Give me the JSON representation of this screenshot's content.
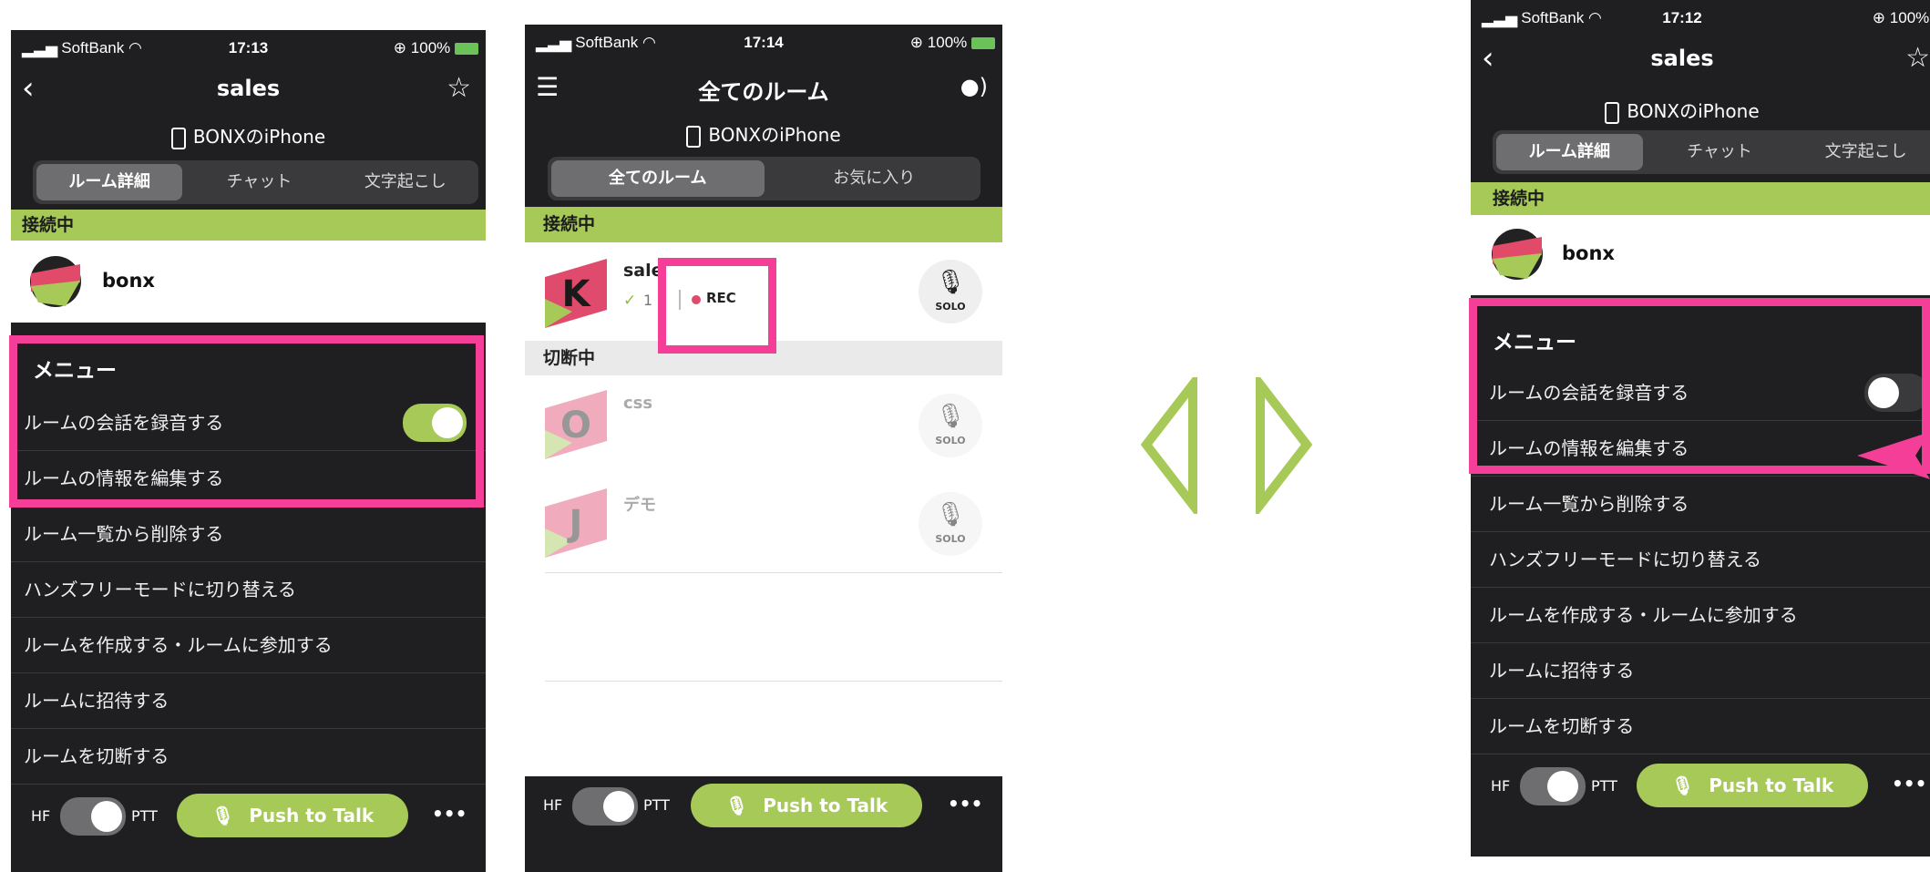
{
  "status": {
    "carrier": "SoftBank",
    "battery": "100%"
  },
  "screens": {
    "left": {
      "time": "17:13",
      "title": "sales",
      "device": "BONXのiPhone",
      "tabs": [
        "ルーム詳細",
        "チャット",
        "文字起こし"
      ],
      "connected_label": "接続中",
      "user": "bonx",
      "menu_header": "メニュー",
      "menu_items": [
        "ルームの会話を録音する",
        "ルームの情報を編集する",
        "ルーム一覧から削除する",
        "ハンズフリーモードに切り替える",
        "ルームを作成する・ルームに参加する",
        "ルームに招待する",
        "ルームを切断する"
      ],
      "record_toggle": "on"
    },
    "middle": {
      "time": "17:14",
      "title": "全てのルーム",
      "device": "BONXのiPhone",
      "tabs": [
        "全てのルーム",
        "お気に入り"
      ],
      "connected_label": "接続中",
      "disconnected_label": "切断中",
      "connected_room": {
        "name": "sale",
        "avatar_letter": "K",
        "sub": "1",
        "rec_label": "REC"
      },
      "rooms": [
        {
          "name": "css",
          "avatar_letter": "O"
        },
        {
          "name": "デモ",
          "avatar_letter": "J"
        }
      ],
      "solo_label": "SOLO"
    },
    "right": {
      "time": "17:12",
      "title": "sales",
      "device": "BONXのiPhone",
      "tabs": [
        "ルーム詳細",
        "チャット",
        "文字起こし"
      ],
      "connected_label": "接続中",
      "user": "bonx",
      "menu_header": "メニュー",
      "menu_items": [
        "ルームの会話を録音する",
        "ルームの情報を編集する",
        "ルーム一覧から削除する",
        "ハンズフリーモードに切り替える",
        "ルームを作成する・ルームに参加する",
        "ルームに招待する",
        "ルームを切断する"
      ],
      "record_toggle": "off"
    }
  },
  "bottom": {
    "hf": "HF",
    "ptt": "PTT",
    "push_to_talk": "Push to Talk",
    "more": "•••"
  },
  "colors": {
    "accent_green": "#a6c957",
    "highlight_pink": "#f53e97",
    "dark_bg": "#1f1f21"
  }
}
